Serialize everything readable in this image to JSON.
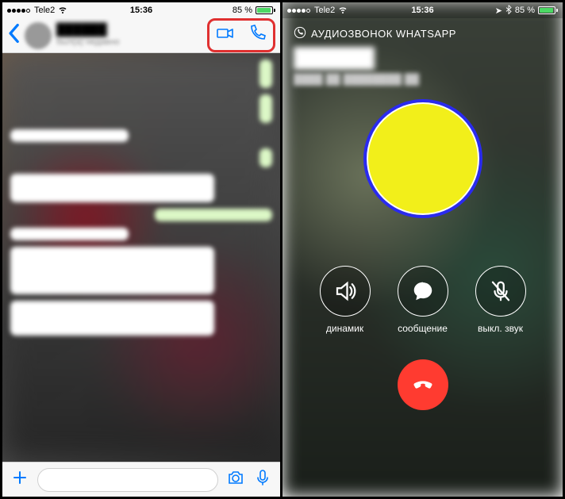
{
  "status": {
    "carrier": "Tele2",
    "time": "15:36",
    "battery_pct": "85 %",
    "battery_fill_pct": 85
  },
  "chat": {
    "contact_name": "██████",
    "contact_status": "был(а) недавно"
  },
  "call": {
    "title": "АУДИОЗВОНОК WHATSAPP",
    "caller_name": "██████",
    "caller_sub": "████ ██ ████████ ██",
    "actions": {
      "speaker": "динамик",
      "message": "сообщение",
      "mute": "выкл. звук"
    }
  }
}
